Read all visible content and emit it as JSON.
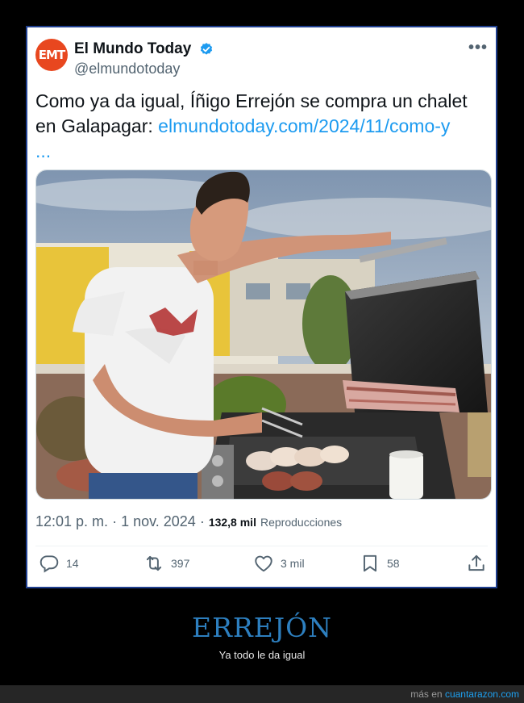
{
  "tweet": {
    "author_name": "El Mundo Today",
    "avatar_text": "EMT",
    "handle": "@elmundotoday",
    "text": "Como ya da igual, Íñigo Errejón se compra un chalet en Galapagar: ",
    "link_text": "elmundotoday.com/2024/11/como-y",
    "link_ellipsis": "...",
    "time": "12:01 p. m.",
    "separator": " · ",
    "date": "1 nov. 2024",
    "views_count": "132,8 mil",
    "views_label": "Reproducciones",
    "replies": "14",
    "retweets": "397",
    "likes": "3 mil",
    "bookmarks": "58"
  },
  "caption": {
    "title": "ERREJÓN",
    "subtitle": "Ya todo le da igual"
  },
  "footer": {
    "prefix": "más en ",
    "link": "cuantarazon.com"
  },
  "colors": {
    "accent": "#1d9bf0",
    "brand_avatar": "#e8471f",
    "caption_title": "#2d7fbf",
    "frame_border": "#1f3f8f"
  }
}
